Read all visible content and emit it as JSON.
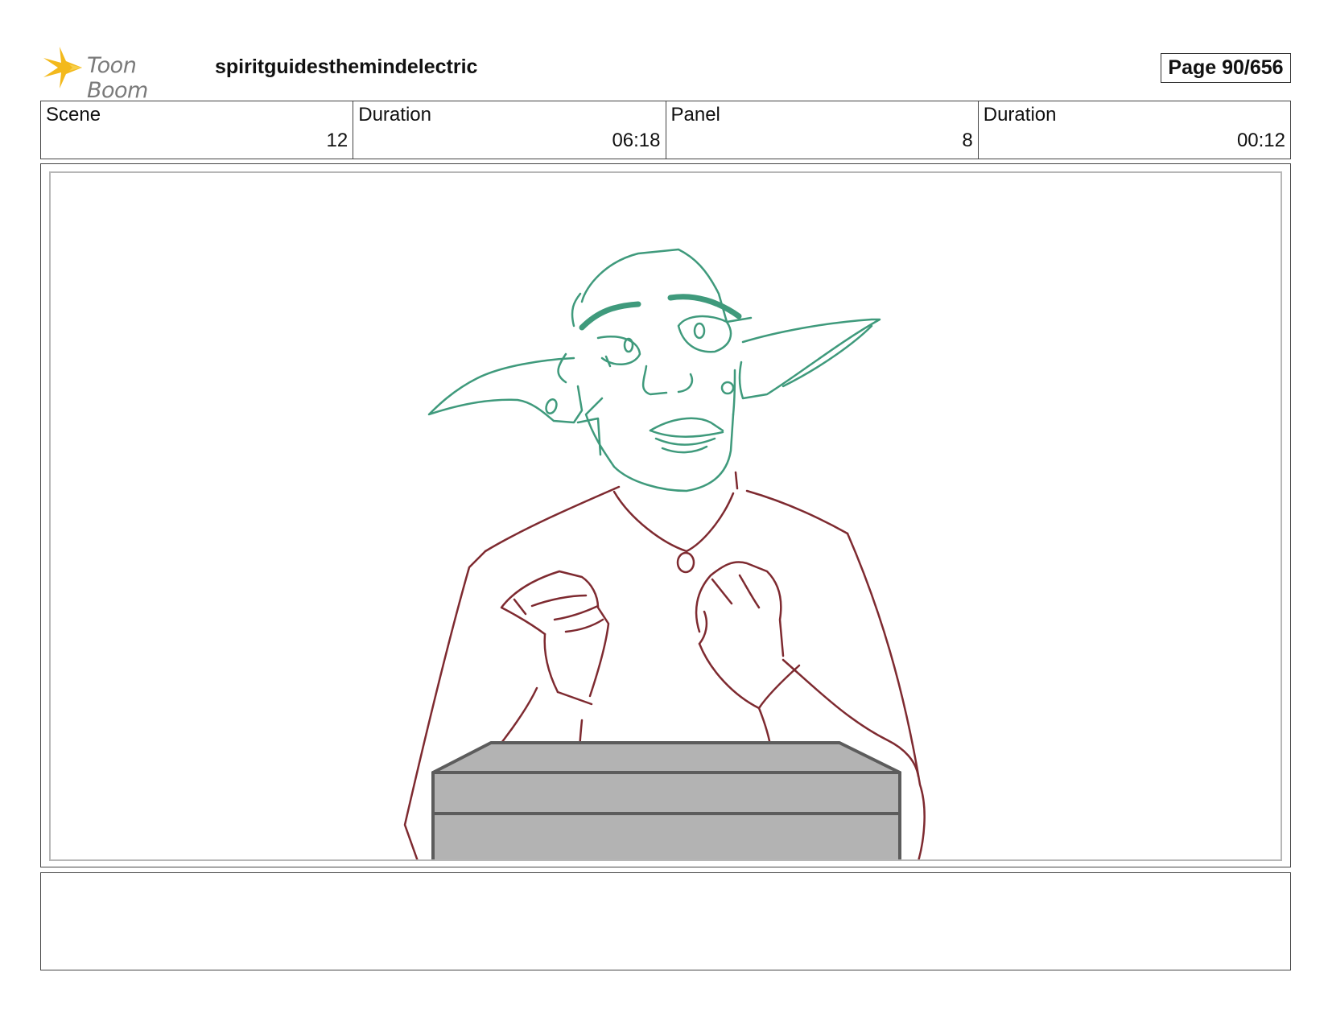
{
  "header": {
    "logo_text": "Toon Boom",
    "project_title": "spiritguidesthemindelectric",
    "page_label": "Page  90/656"
  },
  "info": {
    "scene_label": "Scene",
    "scene_value": "12",
    "scene_duration_label": "Duration",
    "scene_duration_value": "06:18",
    "panel_label": "Panel",
    "panel_value": "8",
    "panel_duration_label": "Duration",
    "panel_duration_value": "00:12"
  },
  "colors": {
    "head_lines": "#3f9a7c",
    "body_lines": "#7e2a30",
    "desk_fill": "#b3b3b3",
    "desk_stroke": "#5c5c5c",
    "logo_star": "#f3b91c"
  },
  "notes": {
    "text": ""
  }
}
